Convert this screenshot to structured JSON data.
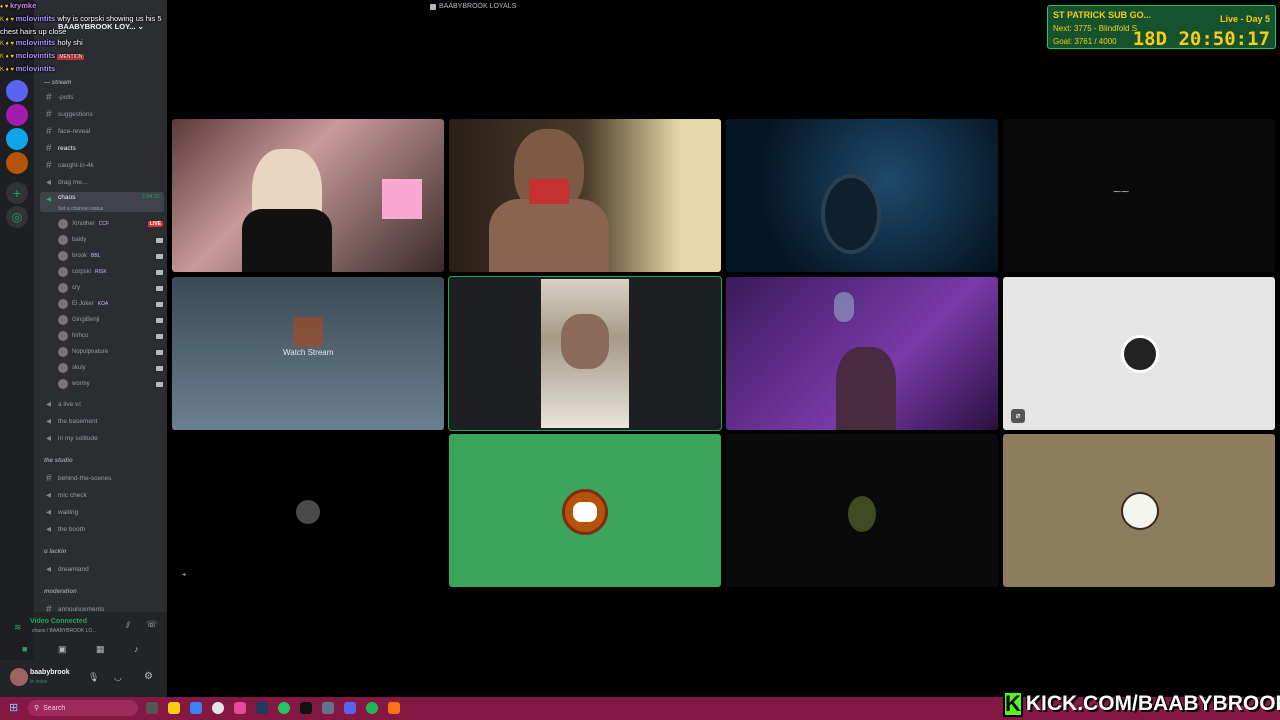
{
  "window_title": "BAABYBROOK LOYALS",
  "server_name": "BAABYBROOK LOY...",
  "chat": [
    {
      "user": "krymke",
      "msg": ""
    },
    {
      "user": "mclovintits",
      "msg": "why is corpski showing us his 5"
    },
    {
      "user": "",
      "msg": "chest hairs up close"
    },
    {
      "user": "mclovintits",
      "msg": "holy shi"
    },
    {
      "user": "mclovintits",
      "msg": "MENTION"
    },
    {
      "user": "mclovintits",
      "msg": ""
    }
  ],
  "channels": [
    {
      "label": "stream",
      "type": "category",
      "y": 80
    },
    {
      "label": "-polls",
      "type": "text"
    },
    {
      "label": "suggestions",
      "type": "text"
    },
    {
      "label": "face-reveal",
      "type": "text"
    },
    {
      "label": "reacts",
      "type": "text"
    },
    {
      "label": "caught-in-4k",
      "type": "text"
    },
    {
      "label": "drag me...",
      "type": "text"
    },
    {
      "label": "chaos",
      "type": "voice",
      "time": "2:34:31",
      "status": "Set a channel status"
    }
  ],
  "voice_users": [
    {
      "name": "Xmother",
      "tag": "CCF",
      "live": true
    },
    {
      "name": "baldy",
      "tag": ""
    },
    {
      "name": "brook",
      "tag": "BBL"
    },
    {
      "name": "corpski",
      "tag": "RISK"
    },
    {
      "name": "cry",
      "tag": ""
    },
    {
      "name": "El Joker",
      "tag": "KOA"
    },
    {
      "name": "GingiBenji",
      "tag": ""
    },
    {
      "name": "hirhco",
      "tag": ""
    },
    {
      "name": "Nopulpnature",
      "tag": ""
    },
    {
      "name": "skuly",
      "tag": ""
    },
    {
      "name": "wormy",
      "tag": ""
    }
  ],
  "lower_channels": [
    {
      "label": "a live vc",
      "type": "voice"
    },
    {
      "label": "the basement",
      "type": "voice"
    },
    {
      "label": "in my solitude",
      "type": "voice"
    },
    {
      "label": "the studio",
      "type": "category"
    },
    {
      "label": "behind-the-scenes",
      "type": "text"
    },
    {
      "label": "mic check",
      "type": "voice"
    },
    {
      "label": "waiting",
      "type": "voice"
    },
    {
      "label": "the booth",
      "type": "voice"
    },
    {
      "label": "u lackin",
      "type": "category"
    },
    {
      "label": "dreamland",
      "type": "voice"
    },
    {
      "label": "moderation",
      "type": "category"
    },
    {
      "label": "announcements",
      "type": "text"
    }
  ],
  "voice_panel": {
    "status": "Video Connected",
    "sub": "chaos / BAABYBROOK LO..."
  },
  "user_panel": {
    "name": "baabybrook",
    "status": "In voice"
  },
  "watch_stream_label": "Watch Stream",
  "subathon": {
    "title": "ST PATRICK SUB GO...",
    "next": "Next: 3775 - Blindfold S",
    "goal": "Goal: 3761 / 4000",
    "live": "Live - Day 5",
    "countdown": "18D 20:50:17"
  },
  "taskbar": {
    "search_label": "Search"
  },
  "kick_banner": "KICK.COM/BAABYBROOK",
  "colors": {
    "accent": "#23a55a",
    "kick_green": "#53fc18",
    "discord_green": "#3ba55c",
    "taskbar": "#831843"
  }
}
